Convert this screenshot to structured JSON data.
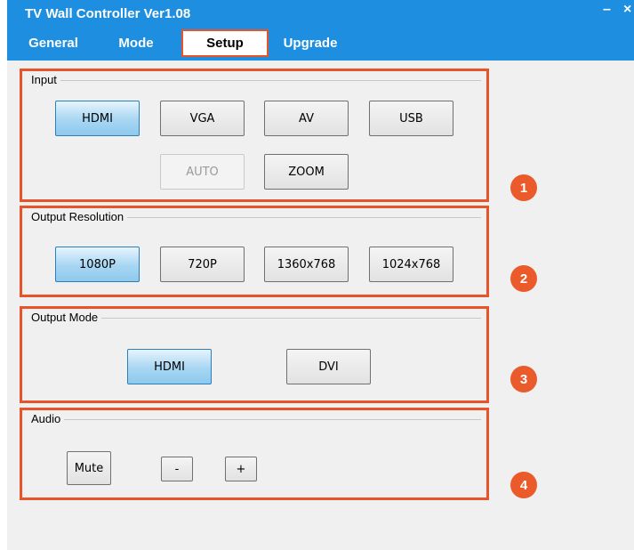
{
  "app": {
    "title": "TV Wall Controller Ver1.08",
    "minimize_glyph": "–",
    "close_glyph": "×"
  },
  "tabs": [
    {
      "label": "General"
    },
    {
      "label": "Mode"
    },
    {
      "label": "Setup",
      "active": true
    },
    {
      "label": "Upgrade"
    }
  ],
  "input": {
    "label": "Input",
    "buttons": [
      {
        "label": "HDMI",
        "state": "selected"
      },
      {
        "label": "VGA"
      },
      {
        "label": "AV"
      },
      {
        "label": "USB"
      },
      {
        "label": "AUTO",
        "state": "disabled"
      },
      {
        "label": "ZOOM"
      }
    ],
    "marker": "1"
  },
  "output_resolution": {
    "label": "Output Resolution",
    "buttons": [
      {
        "label": "1080P",
        "state": "selected"
      },
      {
        "label": "720P"
      },
      {
        "label": "1360x768"
      },
      {
        "label": "1024x768"
      }
    ],
    "marker": "2"
  },
  "output_mode": {
    "label": "Output Mode",
    "buttons": [
      {
        "label": "HDMI",
        "state": "selected"
      },
      {
        "label": "DVI"
      }
    ],
    "marker": "3"
  },
  "audio": {
    "label": "Audio",
    "buttons": [
      {
        "label": "Mute"
      },
      {
        "label": "-"
      },
      {
        "label": "+"
      }
    ],
    "marker": "4"
  },
  "colors": {
    "titlebar": "#1e8fe0",
    "highlight": "#e8542a",
    "marker": "#ea5a2a",
    "selected_button": "#8ec9ee"
  }
}
